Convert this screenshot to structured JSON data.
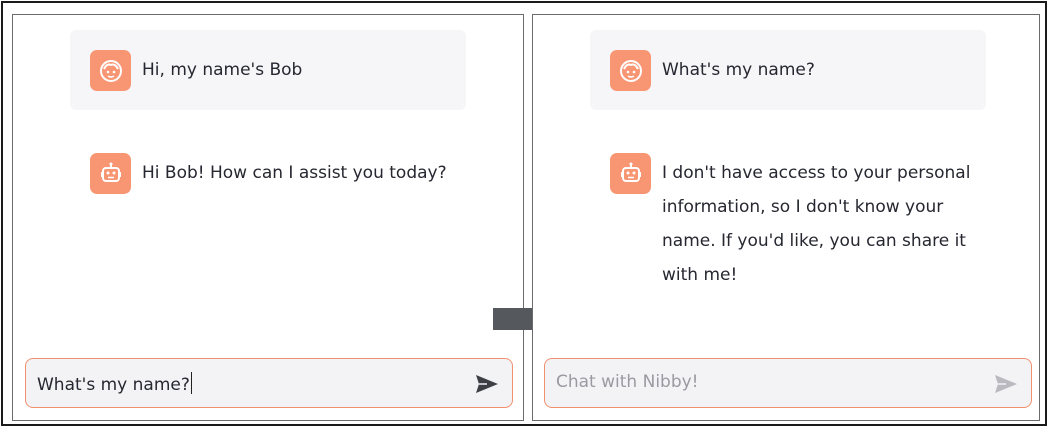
{
  "left_panel": {
    "user_message": "Hi, my name's Bob",
    "bot_message": "Hi Bob! How can I assist you today?",
    "input_value": "What's my name?"
  },
  "right_panel": {
    "user_message": "What's my name?",
    "bot_message": "I don't have access to your personal information, so I don't know your name. If you'd like, you can share it with me!",
    "input_placeholder": "Chat with Nibby!"
  },
  "icons": {
    "user_avatar": "user-face-icon",
    "bot_avatar": "robot-icon",
    "send": "send-icon",
    "transition": "right-arrow-icon"
  },
  "colors": {
    "avatar_bg": "#f89572",
    "input_border": "#f0906e",
    "user_msg_bg": "#f6f6f8",
    "text": "#262730",
    "placeholder": "#9a9aa2",
    "arrow": "#55585d"
  }
}
